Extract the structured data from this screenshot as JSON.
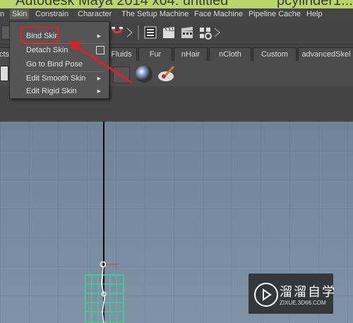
{
  "window": {
    "title": "Autodesk Maya 2014 x64: untitled",
    "title_right": "pcylinder1..."
  },
  "menubar": {
    "items": [
      {
        "label": "n"
      },
      {
        "label": "Skin"
      },
      {
        "label": "Constrain"
      },
      {
        "label": "Character"
      },
      {
        "label": "The Setup Machine"
      },
      {
        "label": "Face Machine"
      },
      {
        "label": "Pipeline Cache"
      },
      {
        "label": "Help"
      }
    ],
    "active": "Skin"
  },
  "skin_menu": {
    "items": [
      {
        "label": "Bind Skin",
        "submenu": true
      },
      {
        "label": "Detach Skin",
        "option_box": true
      },
      {
        "label": "Go to Bind Pose"
      },
      {
        "label": "Edit Smooth Skin",
        "submenu": true
      },
      {
        "label": "Edit Rigid Skin",
        "submenu": true
      }
    ],
    "highlighted": "Bind Skin"
  },
  "shelf_tabs": [
    "cts",
    "Fluids",
    "Fur",
    "nHair",
    "nCloth",
    "Custom",
    "advancedSkel"
  ],
  "watermark": {
    "title": "溜溜自学",
    "subtitle": "ZIXUE.3D66.COM"
  },
  "colors": {
    "titlebar": "#b8d66a",
    "annotation_red": "#e02020",
    "joint_green": "#2fe08a",
    "viewport": "#7b8ea3"
  }
}
